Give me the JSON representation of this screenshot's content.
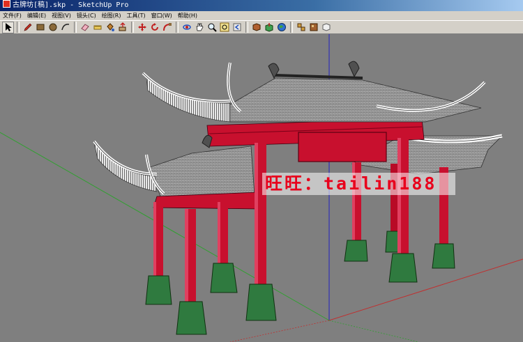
{
  "window": {
    "title": "古牌坊[稿].skp - SketchUp Pro"
  },
  "menu": {
    "items": [
      {
        "label": "文件(F)"
      },
      {
        "label": "编辑(E)"
      },
      {
        "label": "视图(V)"
      },
      {
        "label": "镜头(C)"
      },
      {
        "label": "绘图(R)"
      },
      {
        "label": "工具(T)"
      },
      {
        "label": "窗口(W)"
      },
      {
        "label": "帮助(H)"
      }
    ]
  },
  "toolbar": {
    "tools": [
      {
        "icon": "select-arrow-icon"
      },
      {
        "icon": "pencil-icon"
      },
      {
        "icon": "rectangle-icon"
      },
      {
        "icon": "circle-icon"
      },
      {
        "icon": "arc-icon"
      },
      {
        "icon": "eraser-icon"
      },
      {
        "icon": "tape-measure-icon"
      },
      {
        "icon": "paint-bucket-icon"
      },
      {
        "icon": "push-pull-icon"
      },
      {
        "icon": "move-icon"
      },
      {
        "icon": "rotate-icon"
      },
      {
        "icon": "follow-me-icon"
      },
      {
        "icon": "orbit-icon"
      },
      {
        "icon": "pan-icon"
      },
      {
        "icon": "zoom-icon"
      },
      {
        "icon": "zoom-extents-icon"
      },
      {
        "icon": "previous-view-icon"
      },
      {
        "icon": "get-models-icon"
      },
      {
        "icon": "share-model-icon"
      },
      {
        "icon": "google-earth-icon"
      },
      {
        "icon": "components-icon"
      },
      {
        "icon": "materials-icon"
      },
      {
        "icon": "styles-icon"
      }
    ]
  },
  "viewport": {
    "watermark": "旺旺：tailin188"
  },
  "colors": {
    "viewport_background": "#7f7f7f",
    "pillar_red": "#c8102e",
    "pillar_base_green": "#2f7a3f",
    "roof_tile": "#9a9a9a",
    "axis_blue": "#2020c0",
    "axis_red": "#c03030",
    "axis_green": "#30a030",
    "watermark_text": "#e8001c"
  }
}
